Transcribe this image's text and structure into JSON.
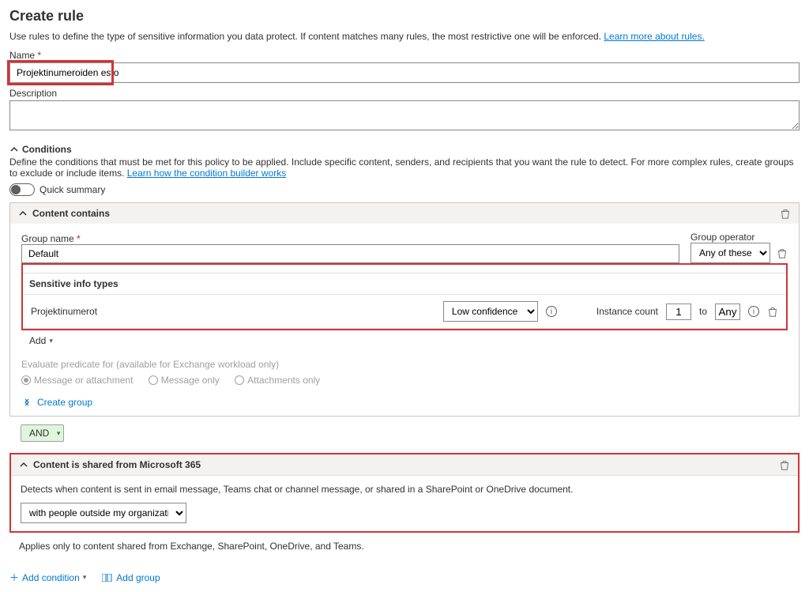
{
  "heading": "Create rule",
  "intro_text": "Use rules to define the type of sensitive information you data protect. If content matches many rules, the most restrictive one will be enforced. ",
  "learn_rules_link": "Learn more about rules.",
  "name": {
    "label": "Name",
    "value": "Projektinumeroiden esto"
  },
  "description": {
    "label": "Description",
    "value": ""
  },
  "conditions": {
    "title": "Conditions",
    "description": "Define the conditions that must be met for this policy to be applied. Include specific content, senders, and recipients that you want the rule to detect. For more complex rules, create groups to exclude or include items. ",
    "builder_link": "Learn how the condition builder works",
    "quick_summary": "Quick summary"
  },
  "content_contains": {
    "title": "Content contains",
    "group_name_label": "Group name",
    "group_name_value": "Default",
    "group_operator_label": "Group operator",
    "group_operator_value": "Any of these",
    "sit_heading": "Sensitive info types",
    "sit_row": {
      "name": "Projektinumerot",
      "confidence": "Low confidence",
      "instance_label": "Instance count",
      "instance_from": "1",
      "instance_to_label": "to",
      "instance_to": "Any"
    },
    "add_label": "Add",
    "evaluate_label": "Evaluate predicate for (available for Exchange workload only)",
    "radio1": "Message or attachment",
    "radio2": "Message only",
    "radio3": "Attachments only",
    "create_group": "Create group"
  },
  "and_label": "AND",
  "content_shared": {
    "title": "Content is shared from Microsoft 365",
    "description": "Detects when content is sent in email message, Teams chat or channel message, or shared in a SharePoint or OneDrive document.",
    "select_value": "with people outside my organization",
    "note": "Applies only to content shared from Exchange, SharePoint, OneDrive, and Teams."
  },
  "bottom": {
    "add_condition": "Add condition",
    "add_group": "Add group"
  }
}
